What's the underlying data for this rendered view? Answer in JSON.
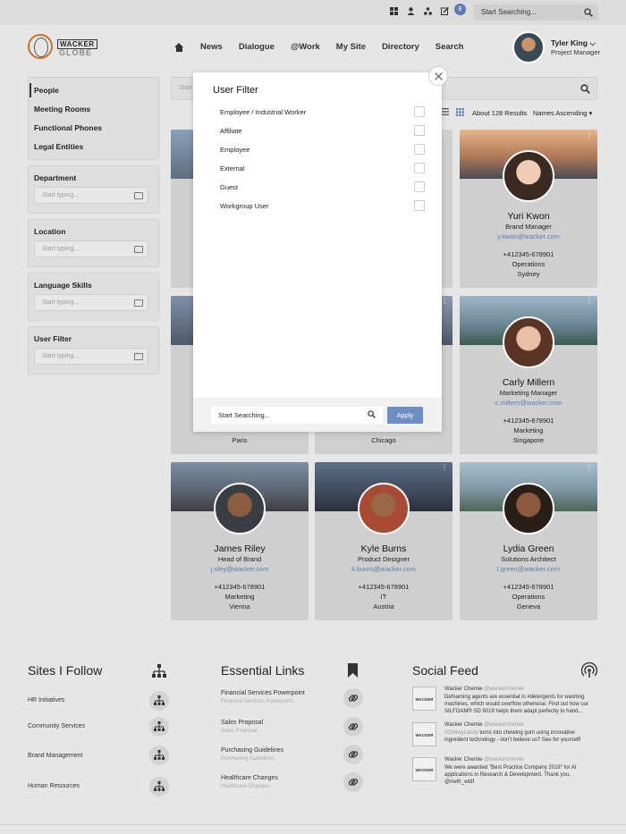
{
  "topbar": {
    "notification_count": "8",
    "search_placeholder": "Start Searching..."
  },
  "header": {
    "logo_word1": "WACKER",
    "logo_word2": "GLOBE",
    "nav": [
      "News",
      "Dialogue",
      "@Work",
      "My Site",
      "Directory",
      "Search"
    ],
    "user_name": "Tyler King",
    "user_role": "Project Manager"
  },
  "sidebar": {
    "links": [
      "People",
      "Meeting Rooms",
      "Functional Phones",
      "Legal Entities"
    ],
    "filters": [
      {
        "title": "Department",
        "placeholder": "Start typing..."
      },
      {
        "title": "Location",
        "placeholder": "Start typing..."
      },
      {
        "title": "Language Skills",
        "placeholder": "Start typing..."
      },
      {
        "title": "User Filter",
        "placeholder": "Start typing..."
      }
    ]
  },
  "main": {
    "search_placeholder": "Start",
    "results": "About 128 Results",
    "sort": "Names Ascending"
  },
  "cards": [
    {
      "name": "Yuri Kwon",
      "role": "Brand Manager",
      "email": "y.kwon@wacker.com",
      "phone": "+412345-678901",
      "dept": "Operations",
      "city": "Sydney"
    },
    {
      "name": "Carly Millern",
      "role": "Marketing Manager",
      "email": "c.millern@wacker.com",
      "phone": "+412345-678901",
      "dept": "Marketing",
      "city": "Singapore"
    },
    {
      "city": "Paris"
    },
    {
      "city": "Chicago"
    },
    {
      "name": "James Riley",
      "role": "Head of Brand",
      "email": "j.riley@wacker.com",
      "phone": "+412345-678901",
      "dept": "Marketing",
      "city": "Vienna"
    },
    {
      "name": "Kyle Burns",
      "role": "Product Designer",
      "email": "k.burns@wacker.com",
      "phone": "+412345-678901",
      "dept": "IT",
      "city": "Austria"
    },
    {
      "name": "Lydia Green",
      "role": "Solutions Architect",
      "email": "l.green@wacker.com",
      "phone": "+412345-678901",
      "dept": "Operations",
      "city": "Geneva"
    }
  ],
  "modal": {
    "title": "User Filter",
    "options": [
      "Employee / Industrial Worker",
      "Affiliate",
      "Employee",
      "External",
      "Guest",
      "Workgroup User"
    ],
    "search_placeholder": "Start Searching...",
    "apply_label": "Apply"
  },
  "sites": {
    "title": "Sites I Follow",
    "items": [
      "HR Initiatives",
      "Community Services",
      "Brand Management",
      "Human Resources"
    ]
  },
  "links": {
    "title": "Essential Links",
    "items": [
      {
        "title": "Financial Services Powerpoint",
        "sub": "Financial Services Powerpoint"
      },
      {
        "title": "Sales Proposal",
        "sub": "Sales Proposal"
      },
      {
        "title": "Purchasing Guidelines",
        "sub": "Purchasing Guidelines"
      },
      {
        "title": "Healthcare Changes",
        "sub": "Healthcare Changes"
      }
    ]
  },
  "feed": {
    "title": "Social Feed",
    "logo_text": "WACKER",
    "items": [
      {
        "author": "Wacker Chemie",
        "handle": "@wackerchemie",
        "text": "Defoaming agents are essential in #detergents for washing machines, which would overflow otherwise. Find out how our SILFOAM® SD 9019 helps them adapt perfectly to hand..."
      },
      {
        "author": "Wacker Chemie",
        "handle": "@wackerchemie",
        "tag": "#Chewycandy",
        "text": " turns into chewing gum using innovative ingredient technology - don't believe us? See for yourself!"
      },
      {
        "author": "Wacker Chemie",
        "handle": "@wackerchemie",
        "text": "We were awarded \"Best Practice Company 2019\" for AI applications in Research & Development. Thank you, @nwth_wtdf"
      }
    ]
  }
}
